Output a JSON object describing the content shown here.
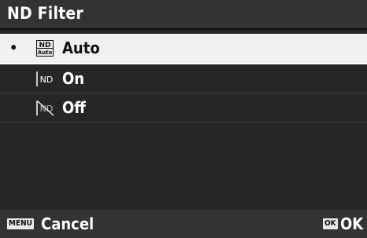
{
  "header": {
    "title": "ND Filter"
  },
  "menu": {
    "items": [
      {
        "label": "Auto",
        "icon": "nd-auto-icon",
        "icon_top": "ND",
        "icon_bottom": "Auto",
        "selected": true,
        "bullet": "•"
      },
      {
        "label": "On",
        "icon": "nd-on-icon",
        "icon_text": "ND",
        "selected": false
      },
      {
        "label": "Off",
        "icon": "nd-off-icon",
        "icon_text": "ND",
        "selected": false
      }
    ]
  },
  "footer": {
    "menu_key": "MENU",
    "cancel_label": "Cancel",
    "ok_key": "OK",
    "ok_label": "OK"
  },
  "colors": {
    "background": "#262626",
    "bar": "#333333",
    "selected_row": "#f0f0f0",
    "text": "#ffffff"
  }
}
